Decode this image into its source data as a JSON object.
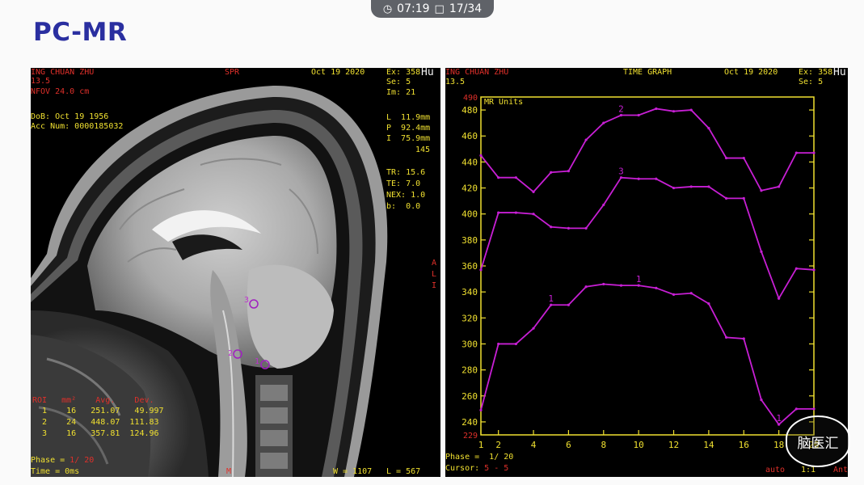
{
  "topbar": {
    "time": "07:19",
    "page": "17/34",
    "clock_icon": "clock-icon",
    "page_icon": "page-icon"
  },
  "slide": {
    "title": "PC-MR"
  },
  "mri": {
    "hdr_name": "ING CHUAN ZHU",
    "hdr_num": "13.5",
    "hdr_fov": "NFOV 24.0 cm",
    "hdr_center": "SPR",
    "hdr_date": "Oct 19 2020",
    "hdr_ex": "Ex: 358",
    "hdr_se": "Se: 5",
    "hdr_im": "Im: 21",
    "hdr_hu": "Hu",
    "dob": "DoB: Oct 19 1956",
    "acc": "Acc Num: 0000185032",
    "coord_l": "L  11.9mm",
    "coord_p": "P  92.4mm",
    "coord_i": "I  75.9mm",
    "coord_n": "145",
    "tr": "TR: 15.6",
    "te": "TE: 7.0",
    "nex": "NEX: 1.0",
    "b": "b:  0.0",
    "side_a": "A",
    "side_l": "L",
    "side_i": "I",
    "roi_head": "ROI   mm²    Avg.    Dev.",
    "roi_rows": [
      "  1    16   251.07   49.997",
      "  2    24   448.07  111.83",
      "  3    16   357.81  124.96"
    ],
    "phase_label": "Phase = ",
    "phase_val": "1/ 20",
    "time_label": "Time = 0ms",
    "foot_m": "M",
    "foot_w": "W = 1107",
    "foot_l": "L = 567",
    "roi_markers": [
      "3",
      "2",
      "1"
    ]
  },
  "graph": {
    "hdr_name": "ING CHUAN ZHU",
    "hdr_num": "13.5",
    "hdr_center": "TIME GRAPH",
    "hdr_date": "Oct 19 2020",
    "hdr_ex": "Ex: 358",
    "hdr_se": "Se: 5",
    "hdr_hu": "Hu",
    "phase": "Phase =  1/ 20",
    "cursor_label": "Cursor: ",
    "cursor_val": "5 - 5",
    "foot_auto": "auto",
    "foot_scale": "1:1",
    "foot_cut": "Ant"
  },
  "chart_data": {
    "type": "line",
    "title": "",
    "ylabel": "MR Units",
    "ylim": [
      230,
      490
    ],
    "xlim": [
      1,
      20
    ],
    "x_ticks": [
      1,
      2,
      4,
      6,
      8,
      10,
      12,
      14,
      16,
      18,
      20
    ],
    "y_ticks": [
      240,
      260,
      280,
      300,
      320,
      340,
      360,
      380,
      400,
      420,
      440,
      460,
      480
    ],
    "y_tick_labels": [
      "240",
      "260",
      "280",
      "300",
      "320",
      "340",
      "360",
      "380",
      "400",
      "420",
      "440",
      "460",
      "480"
    ],
    "top_label": "490",
    "bottom_label": "229",
    "x": [
      1,
      2,
      3,
      4,
      5,
      6,
      7,
      8,
      9,
      10,
      11,
      12,
      13,
      14,
      15,
      16,
      17,
      18,
      19,
      20
    ],
    "series": [
      {
        "name": "2",
        "label_at": 9,
        "values": [
          445,
          428,
          428,
          417,
          432,
          433,
          457,
          470,
          476,
          476,
          481,
          479,
          480,
          466,
          443,
          443,
          418,
          421,
          447,
          447
        ]
      },
      {
        "name": "3",
        "label_at": 9,
        "values": [
          357,
          401,
          401,
          400,
          390,
          389,
          389,
          407,
          428,
          427,
          427,
          420,
          421,
          421,
          412,
          412,
          371,
          335,
          358,
          357
        ]
      },
      {
        "name": "1",
        "label_at": 5,
        "label_at2": 10,
        "label_at3": 18,
        "values": [
          249,
          300,
          300,
          312,
          330,
          330,
          344,
          346,
          345,
          345,
          343,
          338,
          339,
          331,
          305,
          304,
          257,
          238,
          250,
          250
        ]
      }
    ],
    "colors": {
      "line": "#c71fd4",
      "axis": "#f0e030",
      "label": "#e0302a"
    }
  },
  "watermark": {
    "text": "脑医汇"
  }
}
